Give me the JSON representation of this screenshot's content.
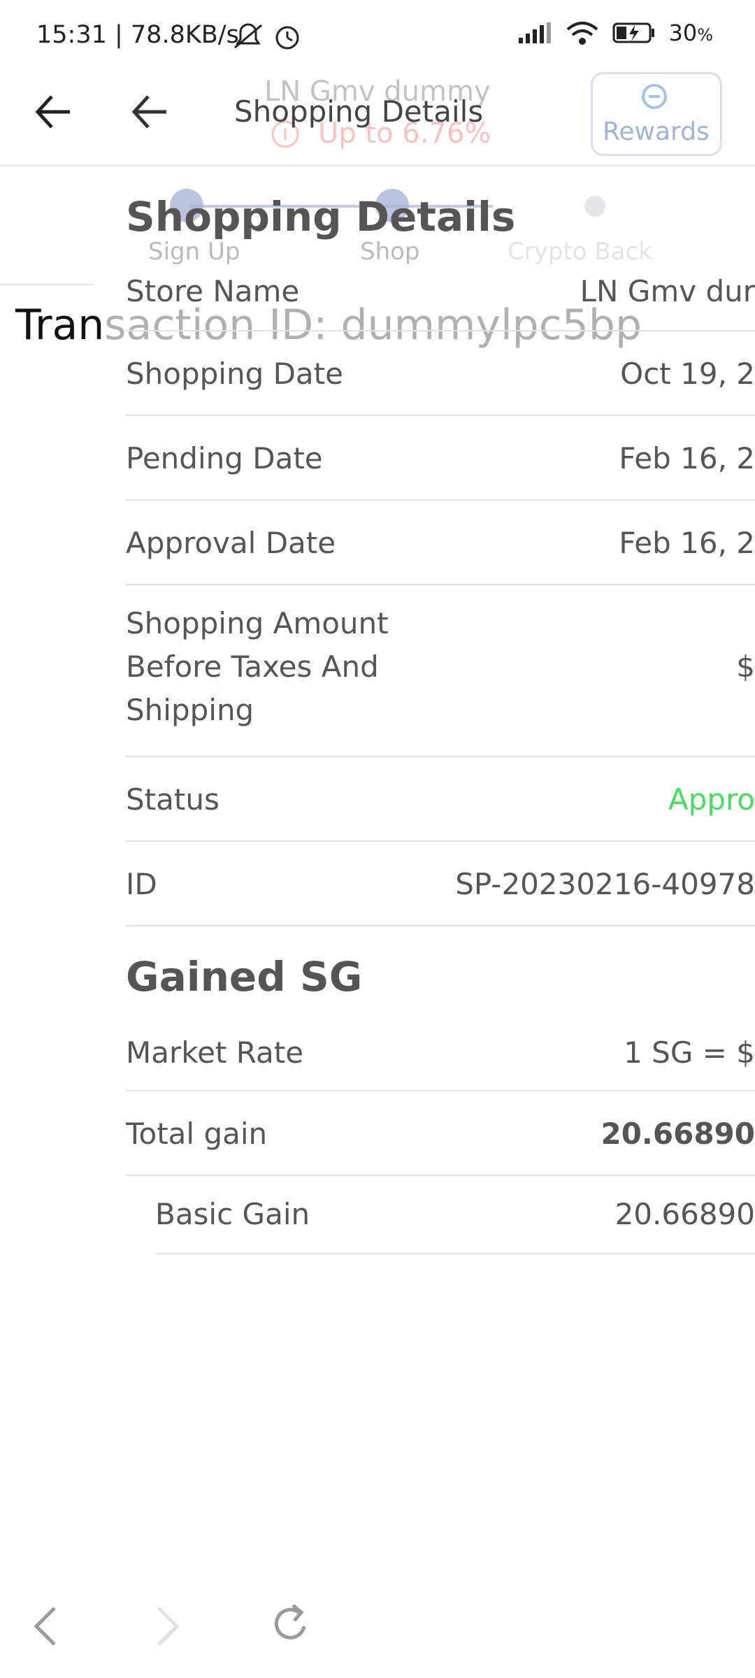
{
  "status_bar": {
    "time_speed": "15:31 | 78.8KB/s",
    "battery": "30",
    "battery_unit": "%"
  },
  "background": {
    "transaction_id": "Transaction ID: dummylpc5bp",
    "store_name": "LN Gmv dummy",
    "up_to": "Up to 6.76%",
    "rewards_label": "Rewards",
    "steps": [
      "Sign Up",
      "Shop",
      "Crypto Back"
    ]
  },
  "panel": {
    "header_title": "Shopping Details",
    "section1_title": "Shopping Details",
    "rows": [
      {
        "label": "Store Name",
        "value": "LN Gmv dur"
      },
      {
        "label": "Shopping Date",
        "value": "Oct 19, 2"
      },
      {
        "label": "Pending Date",
        "value": "Feb 16, 2"
      },
      {
        "label": "Approval Date",
        "value": "Feb 16, 2"
      },
      {
        "label": "Shopping Amount Before Taxes And Shipping",
        "value": "$"
      },
      {
        "label": "Status",
        "value": "Appro"
      },
      {
        "label": "ID",
        "value": "SP-20230216-40978"
      }
    ],
    "section2_title": "Gained SG",
    "gain_rows": [
      {
        "label": "Market Rate",
        "value": "1 SG = $"
      },
      {
        "label": "Total gain",
        "value": "20.66890"
      },
      {
        "label": "Basic Gain",
        "value": "20.66890"
      }
    ]
  },
  "colors": {
    "status_green": "#4cd964",
    "divider": "#e2e2e2",
    "accent_faded": "#aab4d7"
  }
}
